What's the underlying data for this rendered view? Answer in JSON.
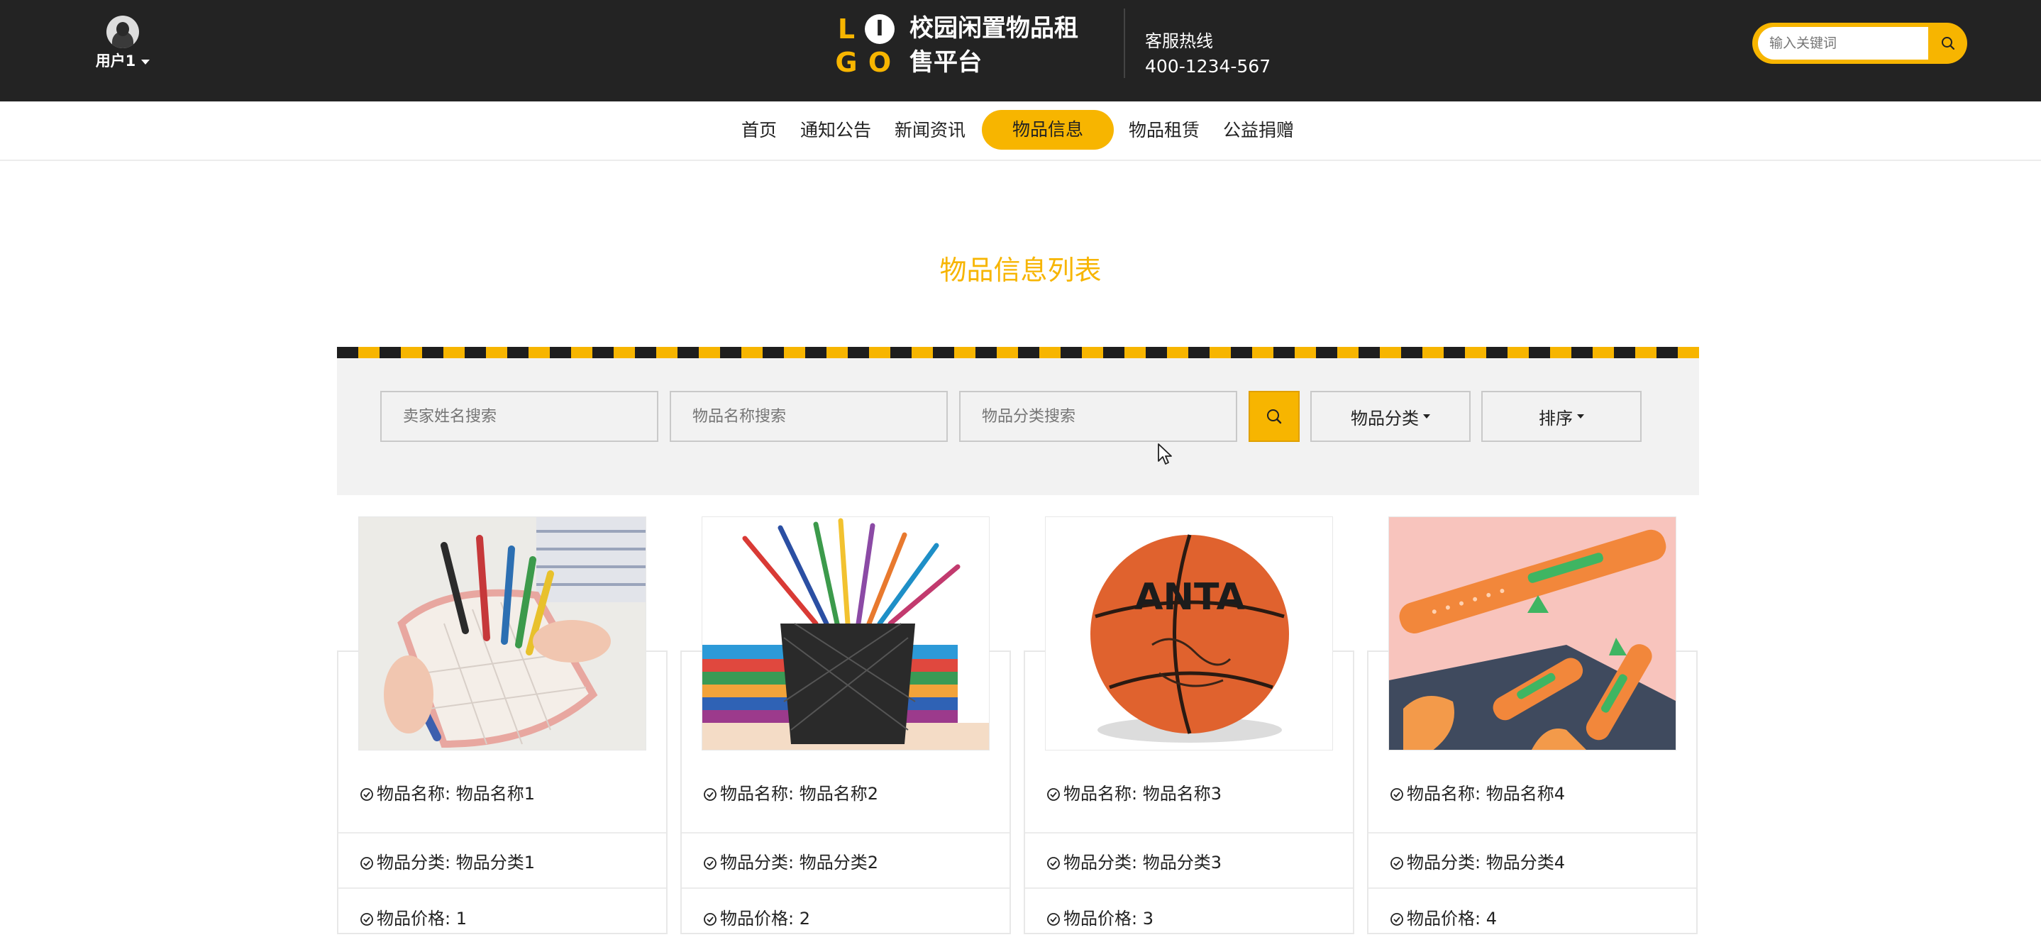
{
  "header": {
    "user_label": "用户1",
    "logo": {
      "l": "L",
      "o1": "I",
      "g": "G",
      "o2": "O"
    },
    "brand": "校园闲置物品租售平台",
    "hotline_label": "客服热线",
    "hotline_number": "400-1234-567",
    "search_placeholder": "输入关键词"
  },
  "nav": {
    "items": [
      "首页",
      "通知公告",
      "新闻资讯",
      "物品信息",
      "物品租赁",
      "公益捐赠"
    ],
    "active": "物品信息"
  },
  "page": {
    "title": "物品信息列表"
  },
  "filters": {
    "seller_placeholder": "卖家姓名搜索",
    "name_placeholder": "物品名称搜索",
    "category_placeholder": "物品分类搜索",
    "category_dropdown": "物品分类",
    "sort_dropdown": "排序"
  },
  "products": [
    {
      "name_label": "物品名称: 物品名称1",
      "category_label": "物品分类: 物品分类1",
      "price_label": "物品价格: 1"
    },
    {
      "name_label": "物品名称: 物品名称2",
      "category_label": "物品分类: 物品分类2",
      "price_label": "物品价格: 2"
    },
    {
      "name_label": "物品名称: 物品名称3",
      "category_label": "物品分类: 物品分类3",
      "price_label": "物品价格: 3"
    },
    {
      "name_label": "物品名称: 物品名称4",
      "category_label": "物品分类: 物品分类4",
      "price_label": "物品价格: 4"
    }
  ],
  "product_images": [
    "pencil-case-image",
    "colored-pencils-image",
    "basketball-image",
    "carrot-cutter-image"
  ],
  "basketball_brand": "ANTA",
  "colors": {
    "accent": "#f7b500",
    "header_bg": "#232323",
    "panel_bg": "#f2f2f2"
  }
}
